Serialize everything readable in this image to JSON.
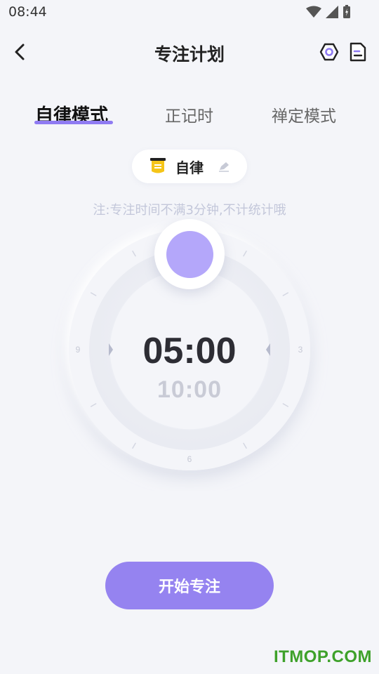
{
  "status_bar": {
    "time": "08:44"
  },
  "nav": {
    "title": "专注计划"
  },
  "tabs": [
    {
      "label": "自律模式",
      "active": true
    },
    {
      "label": "正记时",
      "active": false
    },
    {
      "label": "禅定模式",
      "active": false
    }
  ],
  "mode_chip": {
    "label": "自律"
  },
  "note": "注:专注时间不满3分钟,不计统计哦",
  "dial": {
    "labels": {
      "top": "",
      "right": "3",
      "bottom": "6",
      "left": "9"
    },
    "current_time": "05:00",
    "next_time": "10:00"
  },
  "actions": {
    "start_label": "开始专注"
  },
  "watermark": "ITMOP.COM",
  "colors": {
    "accent": "#9583f0",
    "knob": "#b4a7fa",
    "background": "#f4f5f9",
    "chip_icon": "#f5c518"
  }
}
